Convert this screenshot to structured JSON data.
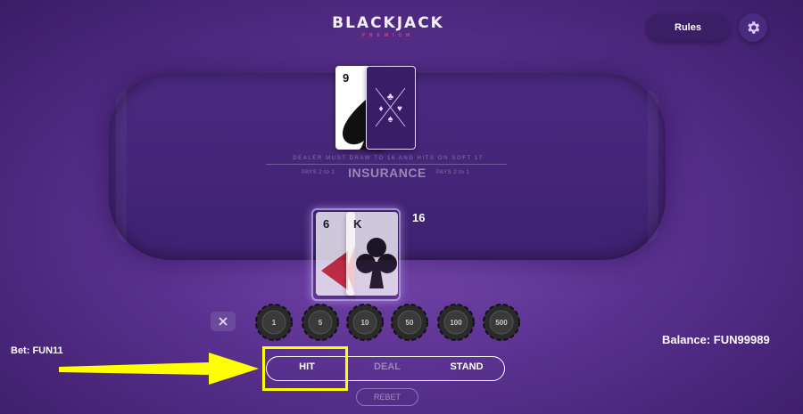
{
  "header": {
    "logo_title": "BLACKJACK",
    "logo_subtitle": "PREMIUM",
    "rules_label": "Rules",
    "settings_icon": "gear-icon"
  },
  "table": {
    "rule_text": "DEALER MUST DRAW TO 16 AND HITS ON SOFT 17",
    "pays_left": "PAYS 2 to 1",
    "insurance_label": "INSURANCE",
    "pays_right": "PAYS 2 to 1"
  },
  "dealer": {
    "cards": [
      {
        "rank": "9",
        "suit": "spades",
        "face_up": true
      },
      {
        "rank": "",
        "suit": "",
        "face_up": false
      }
    ]
  },
  "player": {
    "cards": [
      {
        "rank": "6",
        "suit": "diamonds"
      },
      {
        "rank": "K",
        "suit": "clubs"
      }
    ],
    "total": "16"
  },
  "chips": {
    "clear_icon": "close-icon",
    "values": [
      "1",
      "5",
      "10",
      "50",
      "100",
      "500"
    ]
  },
  "footer": {
    "bet_label": "Bet: FUN11",
    "balance_label": "Balance: FUN99989",
    "hit_label": "HIT",
    "deal_label": "DEAL",
    "stand_label": "STAND",
    "rebet_label": "REBET"
  },
  "annotation": {
    "color": "#ffff00"
  }
}
